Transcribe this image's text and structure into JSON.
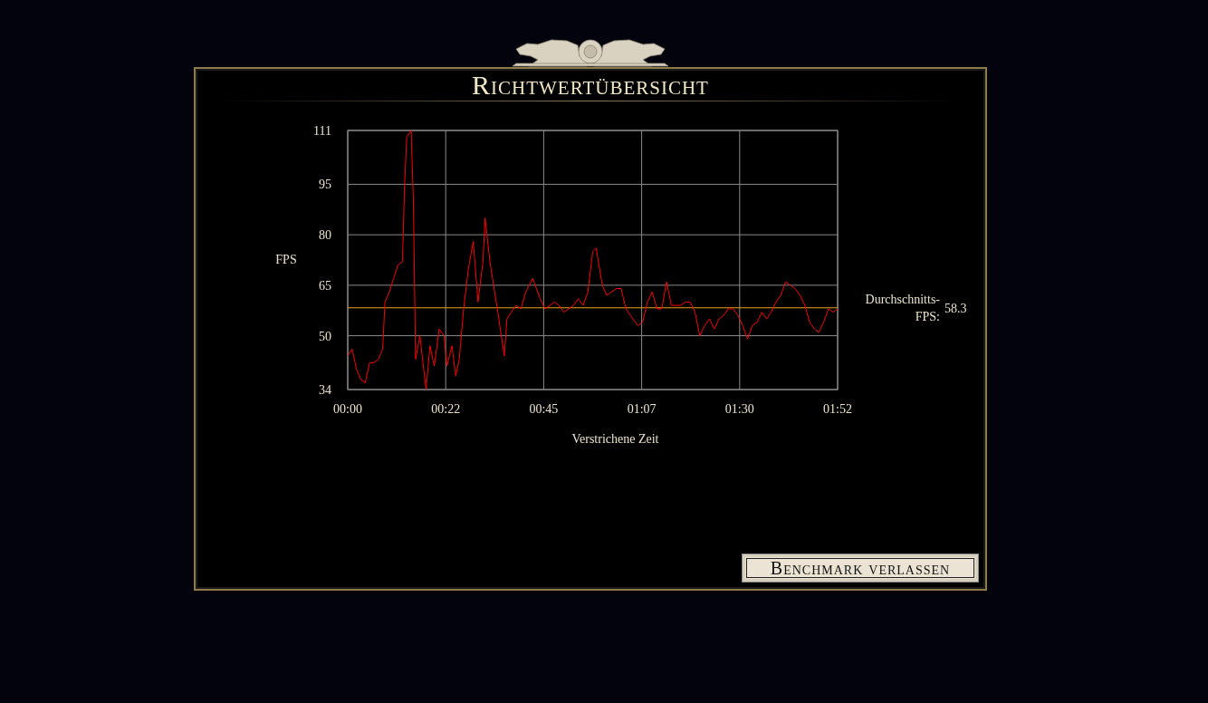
{
  "title": "Richtwertübersicht",
  "chart": {
    "chart_data": {
      "type": "line",
      "xlabel": "Verstrichene Zeit",
      "ylabel": "FPS",
      "x": [
        0,
        1,
        2,
        3,
        4,
        5,
        6,
        7,
        8,
        8.5,
        9.5,
        10.5,
        11.5,
        12.5,
        13,
        13.5,
        14.5,
        15,
        15.5,
        16.5,
        17.9,
        18.8,
        19.8,
        20.9,
        22.0,
        22.7,
        23.8,
        24.7,
        25.5,
        26.5,
        27.6,
        28.7,
        29.8,
        30.9,
        31.4,
        32.5,
        34.2,
        35.8,
        36.4,
        37.4,
        38.5,
        39.6,
        40.7,
        42.3,
        44.0,
        45.1,
        46.2,
        47.3,
        48.3,
        49.4,
        50.5,
        51.6,
        52.7,
        53.8,
        54.9,
        56.0,
        56.8,
        58.2,
        59.2,
        60.3,
        61.4,
        62.5,
        63.6,
        65.2,
        66.3,
        67.4,
        68.5,
        69.6,
        70.7,
        71.8,
        72.9,
        74.0,
        75.0,
        76.1,
        77.2,
        78.3,
        79.4,
        80.5,
        81.6,
        82.7,
        83.8,
        84.9,
        85.9,
        87.0,
        88.1,
        89.2,
        90.3,
        91.4,
        92.5,
        93.6,
        94.7,
        95.8,
        96.8,
        97.9,
        99.0,
        100.1,
        101.2,
        102.3,
        103.4,
        104.5,
        105.6,
        106.7,
        107.7,
        108.8,
        109.9,
        111.0,
        112
      ],
      "series": [
        {
          "color": "#ff0000",
          "values": [
            44,
            46,
            40,
            37,
            36,
            42,
            42,
            43,
            46,
            60,
            63,
            67,
            71,
            72,
            95,
            109,
            111,
            90,
            43,
            50,
            34,
            47,
            41,
            52,
            50,
            41,
            47,
            38,
            43,
            58,
            70,
            78,
            60,
            72,
            85,
            72,
            58,
            44,
            55,
            57,
            59,
            58,
            63,
            67,
            61,
            58,
            59,
            60,
            59,
            57,
            58,
            59,
            61,
            59,
            63,
            75,
            76,
            65,
            62,
            63,
            64,
            64,
            58,
            55,
            53,
            54,
            60,
            63,
            58,
            58,
            66,
            59,
            59,
            59,
            60,
            60,
            57,
            50,
            53,
            55,
            52,
            55,
            56,
            58,
            58,
            56,
            53,
            49,
            53,
            54,
            57,
            55,
            57,
            60,
            62,
            66,
            65,
            64,
            62,
            59,
            54,
            52,
            51,
            54,
            58,
            57,
            58
          ]
        }
      ],
      "xlim": [
        0,
        112
      ],
      "ylim": [
        34,
        111
      ],
      "xticks": [
        {
          "value": 0,
          "label": "00:00"
        },
        {
          "value": 22.4,
          "label": "00:22"
        },
        {
          "value": 44.8,
          "label": "00:45"
        },
        {
          "value": 67.2,
          "label": "01:07"
        },
        {
          "value": 89.6,
          "label": "01:30"
        },
        {
          "value": 112,
          "label": "01:52"
        }
      ],
      "yticks": [
        34,
        50,
        65,
        80,
        95,
        111
      ],
      "grid": true,
      "ref_lines": [
        {
          "axis": "y",
          "value": 58.3,
          "color": "#e8a317",
          "label": "Durchschnitts-FPS:"
        }
      ],
      "annotations": [
        "58.3"
      ]
    }
  },
  "button": {
    "label": "Benchmark verlassen"
  }
}
